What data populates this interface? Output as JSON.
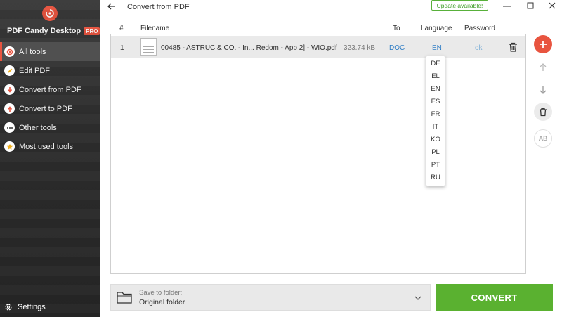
{
  "app": {
    "brand": "PDF Candy Desktop",
    "badge": "PRO",
    "accent": "#e8543f",
    "green": "#5ab130"
  },
  "sidebar": {
    "items": [
      {
        "label": "All tools",
        "icon": "all-tools-icon",
        "active": true
      },
      {
        "label": "Edit PDF",
        "icon": "edit-pdf-icon"
      },
      {
        "label": "Convert from PDF",
        "icon": "convert-from-pdf-icon"
      },
      {
        "label": "Convert to PDF",
        "icon": "convert-to-pdf-icon"
      },
      {
        "label": "Other tools",
        "icon": "other-tools-icon"
      },
      {
        "label": "Most used tools",
        "icon": "star-icon"
      }
    ],
    "settings": "Settings"
  },
  "header": {
    "title": "Convert from PDF",
    "update": "Update available!"
  },
  "table": {
    "headers": {
      "num": "#",
      "filename": "Filename",
      "to": "To",
      "language": "Language",
      "password": "Password"
    },
    "rows": [
      {
        "num": "1",
        "filename": "00485 - ASTRUC & CO. - In... Redom - App 2] - WIO.pdf",
        "size": "323.74 kB",
        "to": "DOC",
        "language": "EN",
        "password": "ok"
      }
    ]
  },
  "language_dropdown": {
    "options": [
      "DE",
      "EL",
      "EN",
      "ES",
      "FR",
      "IT",
      "KO",
      "PL",
      "PT",
      "RU"
    ]
  },
  "folder": {
    "label": "Save to folder:",
    "value": "Original folder"
  },
  "convert_label": "CONVERT"
}
